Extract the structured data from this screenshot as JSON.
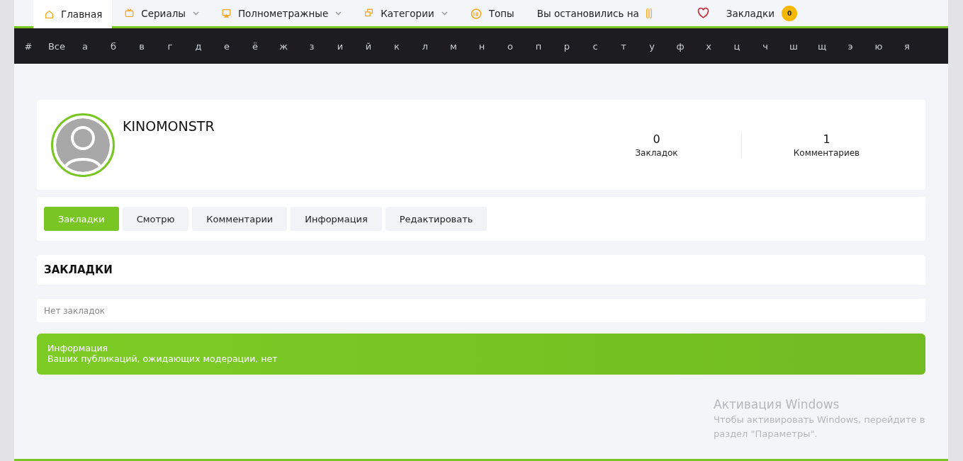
{
  "nav": [
    {
      "kind": "home",
      "label": "Главная",
      "dropdown": false,
      "selected": true
    },
    {
      "kind": "tv",
      "label": "Сериалы",
      "dropdown": true,
      "selected": false
    },
    {
      "kind": "screen",
      "label": "Полнометражные",
      "dropdown": true,
      "selected": false
    },
    {
      "kind": "categories",
      "label": "Категории",
      "dropdown": true,
      "selected": false
    },
    {
      "kind": "tops",
      "label": "Топы",
      "dropdown": false,
      "selected": false
    },
    {
      "kind": "continue",
      "label": "Вы остановились на",
      "dropdown": false,
      "selected": false
    },
    {
      "kind": "bookmarks",
      "label": "Закладки",
      "dropdown": false,
      "selected": false,
      "badge": "0"
    }
  ],
  "alphabet": [
    "#",
    "Все",
    "а",
    "б",
    "в",
    "г",
    "д",
    "е",
    "ё",
    "ж",
    "з",
    "и",
    "й",
    "к",
    "л",
    "м",
    "н",
    "о",
    "п",
    "р",
    "с",
    "т",
    "у",
    "ф",
    "х",
    "ц",
    "ч",
    "ш",
    "щ",
    "э",
    "ю",
    "я"
  ],
  "profile": {
    "username": "KINOMONSTR",
    "stats": [
      {
        "value": "0",
        "label": "Закладок"
      },
      {
        "value": "1",
        "label": "Комментариев"
      }
    ]
  },
  "tabs": [
    {
      "label": "Закладки",
      "selected": true
    },
    {
      "label": "Смотрю",
      "selected": false
    },
    {
      "label": "Комментарии",
      "selected": false
    },
    {
      "label": "Информация",
      "selected": false
    },
    {
      "label": "Редактировать",
      "selected": false
    }
  ],
  "section": {
    "title": "ЗАКЛАДКИ",
    "empty": "Нет закладок"
  },
  "info": {
    "title": "Информация",
    "text": "Ваших публикаций, ожидающих модерации, нет"
  },
  "os_notice": {
    "title": "Активация Windows",
    "text": "Чтобы активировать Windows, перейдите в раздел \"Параметры\"."
  }
}
